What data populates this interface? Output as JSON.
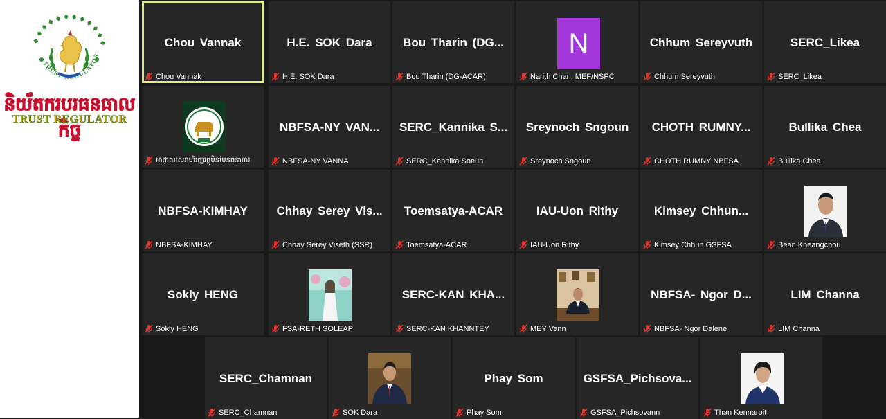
{
  "logo": {
    "khmer_text": "និយ័តករបរធនធាលកិច្ច",
    "english_text": "TRUST REGULATOR",
    "ring_text": "TRUST REGULATOR"
  },
  "participants": [
    {
      "display": "Chou Vannak",
      "label": "Chou Vannak"
    },
    {
      "display": "H.E. SOK Dara",
      "label": "H.E. SOK Dara"
    },
    {
      "display": "Bou Tharin (DG...",
      "label": "Bou Tharin (DG-ACAR)"
    },
    {
      "display": "N",
      "label": "Narith Chan, MEF/NSPC"
    },
    {
      "display": "Chhum Sereyvuth",
      "label": "Chhum Sereyvuth"
    },
    {
      "display": "SERC_Likea",
      "label": "SERC_Likea"
    },
    {
      "display": "",
      "label": "អាជ្ញាធរសេវាហិរញ្ញវត្ថុមិនមែនធនាគារ"
    },
    {
      "display": "NBFSA-NY VAN...",
      "label": "NBFSA-NY VANNA"
    },
    {
      "display": "SERC_Kannika S...",
      "label": "SERC_Kannika Soeun"
    },
    {
      "display": "Sreynoch Sngoun",
      "label": "Sreynoch Sngoun"
    },
    {
      "display": "CHOTH RUMNY...",
      "label": "CHOTH RUMNY NBFSA"
    },
    {
      "display": "Bullika Chea",
      "label": "Bullika Chea"
    },
    {
      "display": "NBFSA-KIMHAY",
      "label": "NBFSA-KIMHAY"
    },
    {
      "display": "Chhay Serey Vis...",
      "label": "Chhay Serey Viseth (SSR)"
    },
    {
      "display": "Toemsatya-ACAR",
      "label": "Toemsatya-ACAR"
    },
    {
      "display": "IAU-Uon Rithy",
      "label": "IAU-Uon Rithy"
    },
    {
      "display": "Kimsey Chhun...",
      "label": "Kimsey Chhun GSFSA"
    },
    {
      "display": "",
      "label": "Bean Kheangchou"
    },
    {
      "display": "Sokly HENG",
      "label": "Sokly HENG"
    },
    {
      "display": "",
      "label": "FSA-RETH SOLEAP"
    },
    {
      "display": "SERC-KAN KHA...",
      "label": "SERC-KAN KHANNTEY"
    },
    {
      "display": "",
      "label": "MEY Vann"
    },
    {
      "display": "NBFSA- Ngor D...",
      "label": "NBFSA- Ngor Dalene"
    },
    {
      "display": "LIM Channa",
      "label": "LIM Channa"
    },
    {
      "display": "SERC_Chamnan",
      "label": "SERC_Chamnan"
    },
    {
      "display": "",
      "label": "SOK Dara"
    },
    {
      "display": "Phay Som",
      "label": "Phay Som"
    },
    {
      "display": "GSFSA_Pichsova...",
      "label": "GSFSA_Pichsovann"
    },
    {
      "display": "",
      "label": "Than Kennaroit"
    }
  ],
  "colors": {
    "active_border": "#e0eb8f",
    "muted_icon": "#e8322c",
    "avatar_bg": "#a336d8"
  }
}
